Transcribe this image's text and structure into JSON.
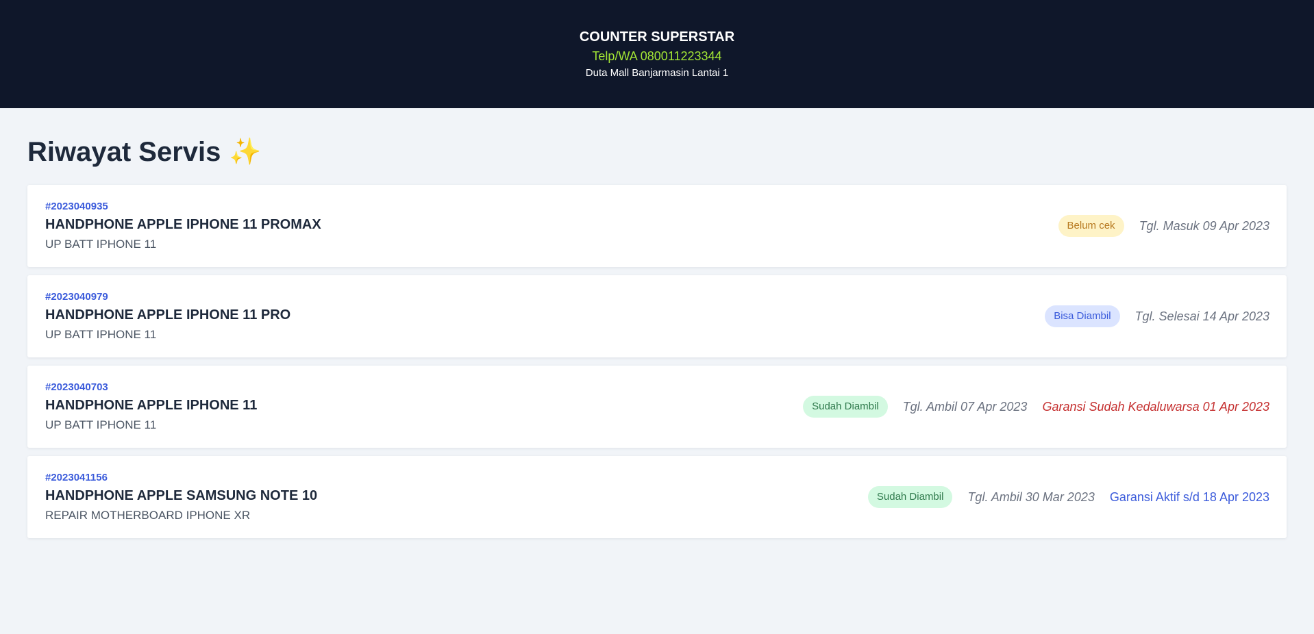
{
  "header": {
    "name": "COUNTER SUPERSTAR",
    "phone": "Telp/WA 080011223344",
    "address": "Duta Mall Banjarmasin Lantai 1"
  },
  "page": {
    "title": "Riwayat Servis",
    "title_emoji": "✨"
  },
  "services": [
    {
      "id": "#2023040935",
      "device": "HANDPHONE APPLE IPHONE 11 PROMAX",
      "service": "UP BATT IPHONE 11",
      "status": "Belum cek",
      "status_color": "yellow",
      "date": "Tgl. Masuk 09 Apr 2023",
      "warranty": ""
    },
    {
      "id": "#2023040979",
      "device": "HANDPHONE APPLE IPHONE 11 PRO",
      "service": "UP BATT IPHONE 11",
      "status": "Bisa Diambil",
      "status_color": "blue",
      "date": "Tgl. Selesai 14 Apr 2023",
      "warranty": ""
    },
    {
      "id": "#2023040703",
      "device": "HANDPHONE APPLE IPHONE 11",
      "service": "UP BATT IPHONE 11",
      "status": "Sudah Diambil",
      "status_color": "green",
      "date": "Tgl. Ambil 07 Apr 2023",
      "warranty": "Garansi Sudah Kedaluwarsa 01 Apr 2023"
    },
    {
      "id": "#2023041156",
      "device": "HANDPHONE APPLE SAMSUNG NOTE 10",
      "service": "REPAIR MOTHERBOARD IPHONE XR",
      "status": "Sudah Diambil",
      "status_color": "green",
      "date": "Tgl. Ambil 30 Mar 2023",
      "warranty": "Garansi Aktif s/d 18 Apr 2023"
    }
  ],
  "colors": {
    "header_bg": "#0f172a",
    "phone": "#a3e635",
    "accent": "#3b5bdb",
    "expired": "#c53030"
  }
}
